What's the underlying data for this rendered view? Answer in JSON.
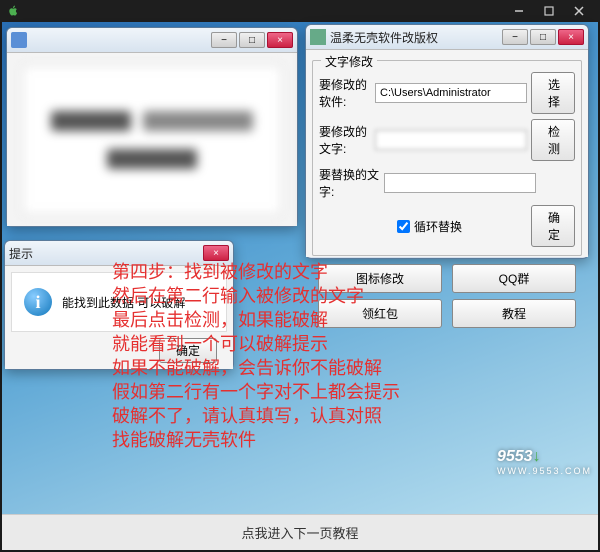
{
  "outer": {
    "min": "−",
    "max": "□",
    "close": "×"
  },
  "w1": {
    "min": "−",
    "max": "□",
    "close": "×"
  },
  "w2": {
    "title": "提示",
    "close": "×",
    "message": "能找到此数据 可以破解",
    "ok": "确定"
  },
  "w3": {
    "title": "温柔无壳软件改版权",
    "min": "−",
    "max": "□",
    "close": "×",
    "group_legend": "文字修改",
    "row1_label": "要修改的软件:",
    "row1_value": "C:\\Users\\Administrator",
    "row1_btn": "选择",
    "row2_label": "要修改的文字:",
    "row2_value": "",
    "row2_btn": "检测",
    "row3_label": "要替换的文字:",
    "row3_value": "",
    "chk_label": "循环替换",
    "chk_btn": "确定",
    "btns": [
      "图标修改",
      "QQ群",
      "领红包",
      "教程"
    ]
  },
  "instructions": {
    "l1": "第四步：找到被修改的文字",
    "l2": "然后在第二行输入被修改的文字",
    "l3": "最后点击检测，如果能破解",
    "l4": "就能看到一个可以破解提示",
    "l5": "如果不能破解，会告诉你不能破解",
    "l6": "假如第二行有一个字对不上都会提示",
    "l7": "破解不了，请认真填写，认真对照",
    "l8": "找能破解无壳软件"
  },
  "footer": "点我进入下一页教程",
  "watermark": {
    "main": "9553",
    "sub": "WWW.9553.COM"
  }
}
